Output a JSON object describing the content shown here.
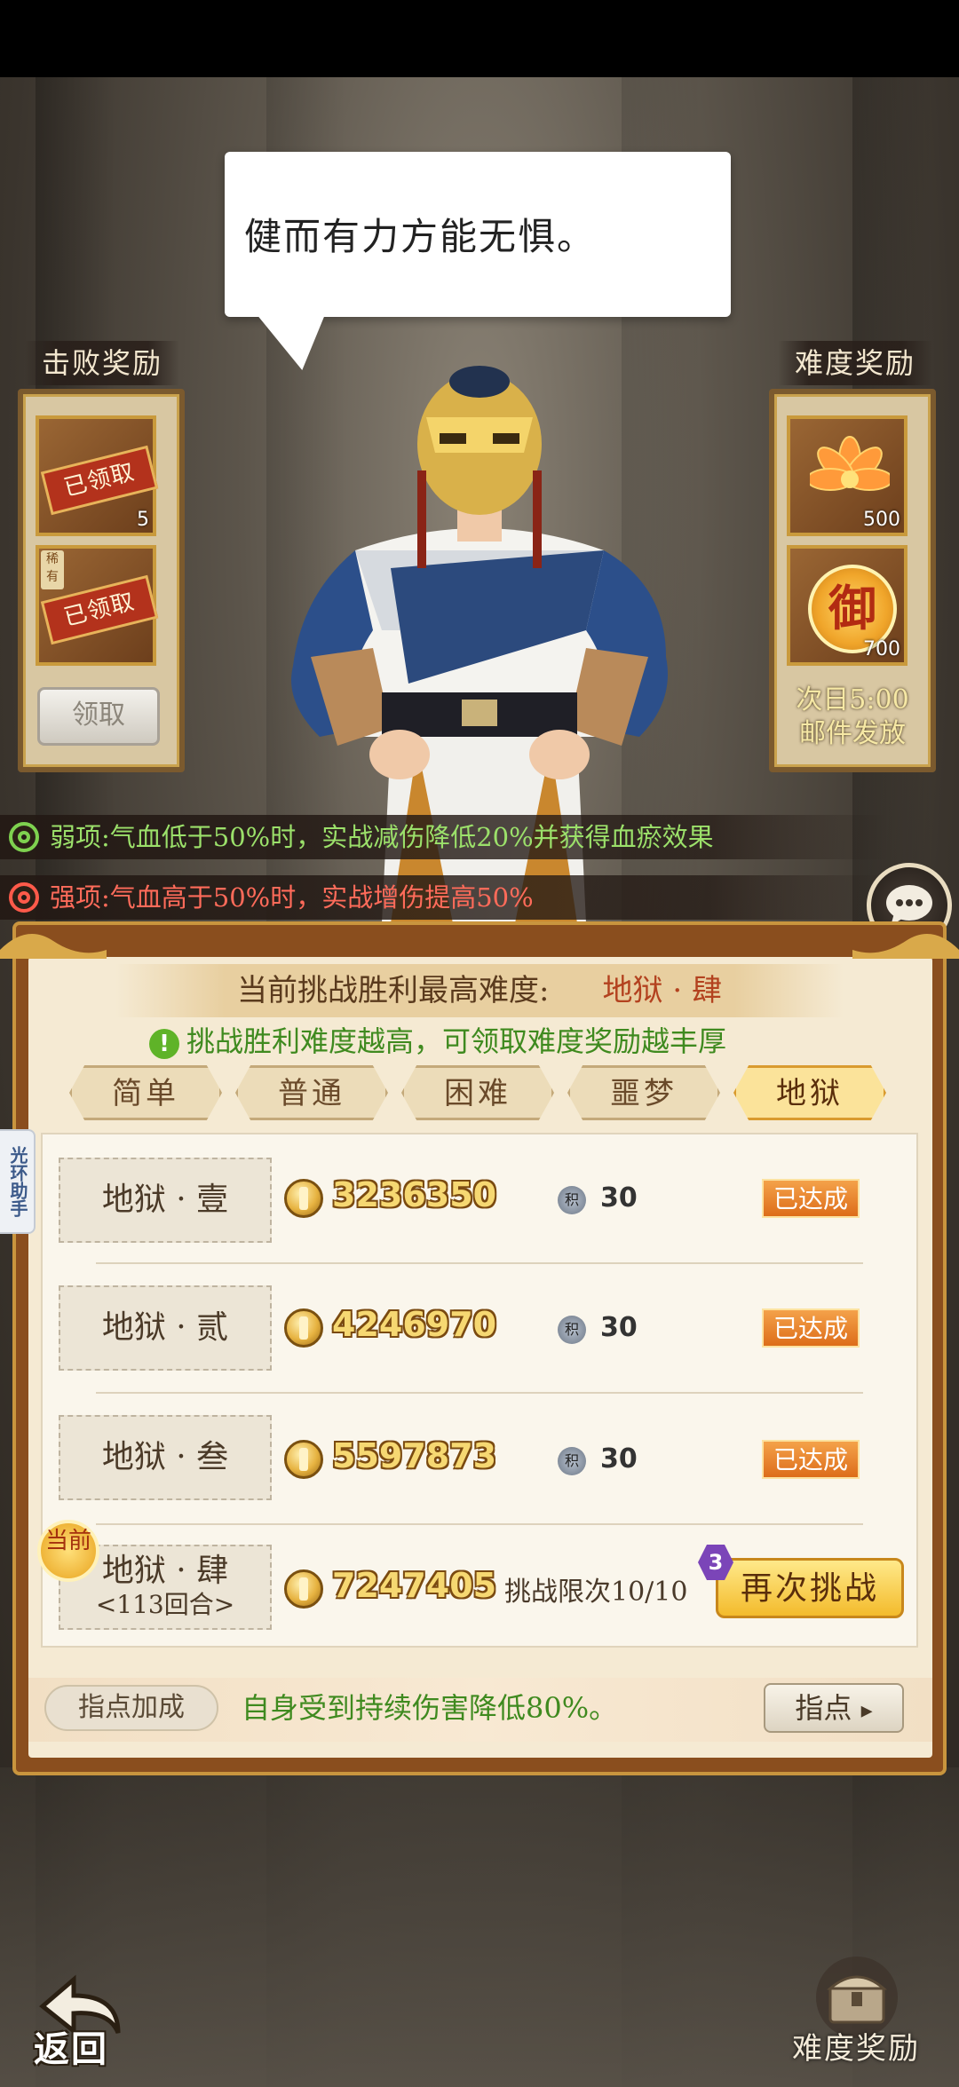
{
  "dialogue": "健而有力方能无惧。",
  "defeat_reward": {
    "title": "击败奖励",
    "items": [
      {
        "stamp": "已领取",
        "count": "5"
      },
      {
        "tag": "稀有",
        "stamp": "已领取"
      }
    ],
    "claim_label": "领取"
  },
  "difficulty_reward": {
    "title": "难度奖励",
    "items": [
      {
        "icon": "lotus-icon",
        "count": "500"
      },
      {
        "icon": "seal-icon",
        "glyph": "御",
        "count": "700"
      }
    ],
    "note_line1": "次日5:00",
    "note_line2": "邮件发放"
  },
  "buffs": {
    "weak": "弱项:气血低于50%时，实战减伤降低20%并获得血瘀效果",
    "strong": "强项:气血高于50%时，实战增伤提高50%"
  },
  "panel": {
    "best_label": "当前挑战胜利最高难度:",
    "best_value": "地狱 · 肆",
    "tip": "挑战胜利难度越高，可领取难度奖励越丰厚",
    "tip_icon": "!",
    "tabs": [
      {
        "label": "简单",
        "active": false
      },
      {
        "label": "普通",
        "active": false
      },
      {
        "label": "困难",
        "active": false
      },
      {
        "label": "噩梦",
        "active": false
      },
      {
        "label": "地狱",
        "active": true
      }
    ],
    "levels": [
      {
        "name": "地狱 · 壹",
        "score": "3236350",
        "pt_icon": "积",
        "points": "30",
        "status": "已达成"
      },
      {
        "name": "地狱 · 贰",
        "score": "4246970",
        "pt_icon": "积",
        "points": "30",
        "status": "已达成"
      },
      {
        "name": "地狱 · 叁",
        "score": "5597873",
        "pt_icon": "积",
        "points": "30",
        "status": "已达成"
      },
      {
        "name": "地狱 · 肆",
        "sub": "<113回合>",
        "score": "7247405",
        "limit": "挑战限次10/10",
        "retry": "再次挑战",
        "badge": "3"
      }
    ],
    "current_badge": "当前",
    "guide_tag": "指点加成",
    "guide_text": "自身受到持续伤害降低80%。",
    "guide_button": "指点"
  },
  "helper_tab": "光环助手",
  "nav": {
    "back": "返回",
    "difficulty_reward": "难度奖励"
  },
  "colors": {
    "accent_gold": "#f3bb2c",
    "achieved_orange": "#dd6d1a",
    "tip_green": "#3f8a1f",
    "weak_green": "#9be06a",
    "strong_red": "#ff6b5a"
  }
}
